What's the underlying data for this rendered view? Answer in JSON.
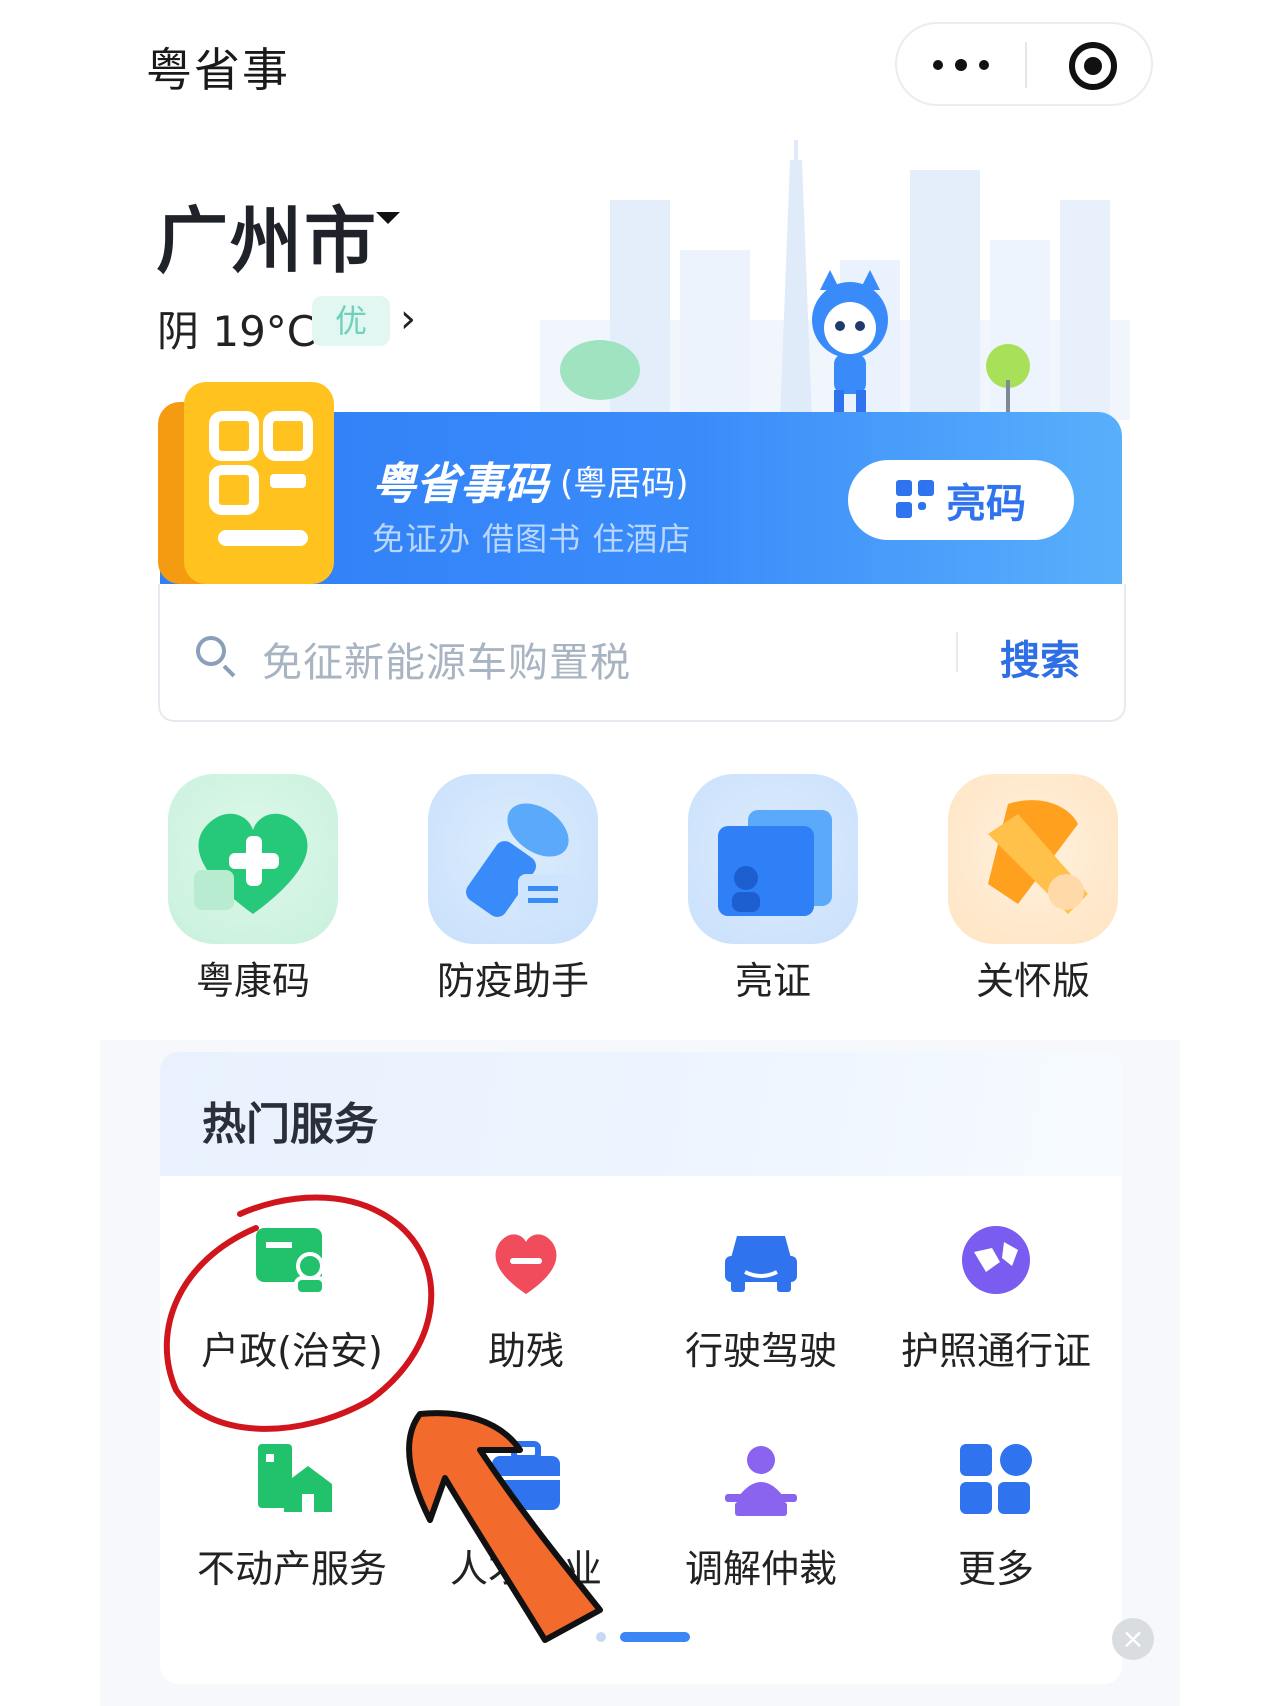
{
  "header": {
    "title": "粤省事"
  },
  "location": {
    "city": "广州市",
    "weather": "阴 19°C",
    "air_quality": "优"
  },
  "code_banner": {
    "title": "粤省事码",
    "subtitle_tag": "(粤居码)",
    "description": "免证办 借图书 住酒店",
    "button_label": "亮码"
  },
  "search": {
    "placeholder": "免征新能源车购置税",
    "button_label": "搜索"
  },
  "quick_tiles": [
    {
      "label": "粤康码",
      "icon": "heart-plus-icon"
    },
    {
      "label": "防疫助手",
      "icon": "flashlight-icon"
    },
    {
      "label": "亮证",
      "icon": "cards-icon"
    },
    {
      "label": "关怀版",
      "icon": "ribbon-icon"
    }
  ],
  "hot_services": {
    "title": "热门服务",
    "items": [
      {
        "label": "户政(治安)",
        "icon": "id-card-person-icon",
        "color": "#21c26b"
      },
      {
        "label": "助残",
        "icon": "heart-icon",
        "color": "#f04c5c"
      },
      {
        "label": "行驶驾驶",
        "icon": "car-icon",
        "color": "#2f74ee"
      },
      {
        "label": "护照通行证",
        "icon": "globe-icon",
        "color": "#7a5cf0"
      },
      {
        "label": "不动产服务",
        "icon": "building-home-icon",
        "color": "#21c26b"
      },
      {
        "label": "人才就业",
        "icon": "briefcase-icon",
        "color": "#2f74ee"
      },
      {
        "label": "调解仲裁",
        "icon": "mediator-icon",
        "color": "#8a63ef"
      },
      {
        "label": "更多",
        "icon": "grid-icon",
        "color": "#2f74ee"
      }
    ]
  },
  "colors": {
    "primary": "#2f74ee",
    "annotation_circle": "#d0161c",
    "annotation_arrow": "#f26a2c"
  }
}
